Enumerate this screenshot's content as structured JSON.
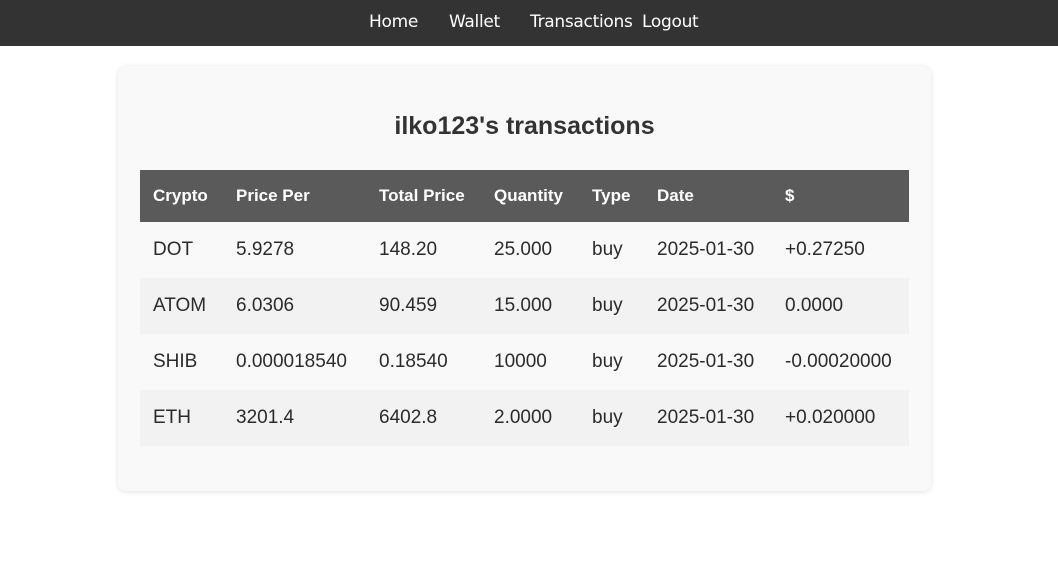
{
  "nav": {
    "home": "Home",
    "wallet": "Wallet",
    "transactions": "Transactions",
    "logout": "Logout"
  },
  "page": {
    "title": "ilko123's transactions"
  },
  "table": {
    "headers": [
      "Crypto",
      "Price Per",
      "Total Price",
      "Quantity",
      "Type",
      "Date",
      "$"
    ],
    "rows": [
      [
        "DOT",
        "5.9278",
        "148.20",
        "25.000",
        "buy",
        "2025-01-30",
        "+0.27250"
      ],
      [
        "ATOM",
        "6.0306",
        "90.459",
        "15.000",
        "buy",
        "2025-01-30",
        "0.0000"
      ],
      [
        "SHIB",
        "0.000018540",
        "0.18540",
        "10000",
        "buy",
        "2025-01-30",
        "-0.00020000"
      ],
      [
        "ETH",
        "3201.4",
        "6402.8",
        "2.0000",
        "buy",
        "2025-01-30",
        "+0.020000"
      ]
    ]
  },
  "colors": {
    "navbar": "#333333",
    "table_header": "#5a5a5a",
    "card": "#f9f9f9",
    "row_alt": "#f2f2f2"
  }
}
